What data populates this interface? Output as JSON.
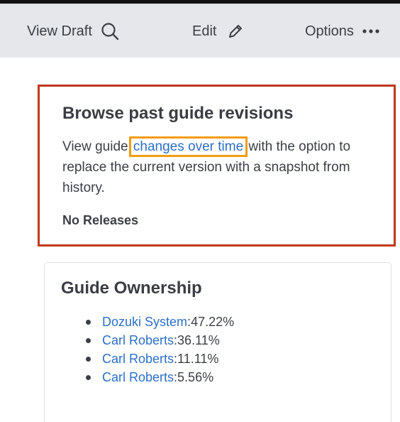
{
  "toolbar": {
    "view_draft_label": "View Draft",
    "edit_label": "Edit",
    "options_label": "Options",
    "icons": {
      "view_draft": "search-icon",
      "edit": "pencil-icon",
      "options": "ellipsis-icon"
    }
  },
  "revisions": {
    "title": "Browse past guide revisions",
    "text_before": "View guide ",
    "link_text": "changes over time",
    "text_after": " with the option to replace the current version with a snapshot from history.",
    "releases": "No Releases",
    "highlight_color": "#c0391c",
    "link_highlight_color": "#f39c12"
  },
  "ownership": {
    "title": "Guide Ownership",
    "items": [
      {
        "name": "Dozuki System",
        "separator": ": ",
        "percent": "47.22%"
      },
      {
        "name": "Carl Roberts",
        "separator": ": ",
        "percent": "36.11%"
      },
      {
        "name": "Carl Roberts",
        "separator": ": ",
        "percent": "11.11%"
      },
      {
        "name": "Carl Roberts",
        "separator": ": ",
        "percent": "5.56%"
      }
    ]
  },
  "colors": {
    "link": "#2c6fc6",
    "toolbar_bg": "#e5e7ea",
    "text": "#3b3f45"
  }
}
